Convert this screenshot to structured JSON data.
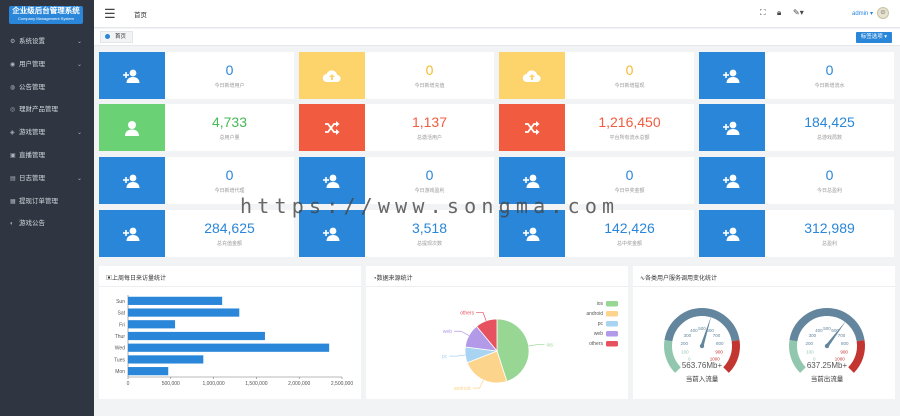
{
  "logo": {
    "title": "企业级后台管理系统",
    "subtitle": "Company Management System"
  },
  "sidebar": {
    "items": [
      {
        "label": "系统设置",
        "icon": "gear-icon",
        "chevron": true
      },
      {
        "label": "用户管理",
        "icon": "user-icon",
        "chevron": true
      },
      {
        "label": "公告管理",
        "icon": "bell-icon",
        "chevron": false
      },
      {
        "label": "理财产品管理",
        "icon": "coin-icon",
        "chevron": false
      },
      {
        "label": "游戏管理",
        "icon": "gamepad-icon",
        "chevron": true
      },
      {
        "label": "直播管理",
        "icon": "video-icon",
        "chevron": false
      },
      {
        "label": "日志管理",
        "icon": "log-icon",
        "chevron": true
      },
      {
        "label": "提现订单管理",
        "icon": "order-icon",
        "chevron": false
      },
      {
        "label": "游戏公告",
        "icon": "megaphone-icon",
        "chevron": false
      }
    ]
  },
  "header": {
    "home": "首页",
    "user": "admin ▾"
  },
  "tabbar": {
    "tab_home": "首页",
    "page_ops": "标签选项 ▾"
  },
  "cards": [
    {
      "value": "0",
      "label": "今日新增用户",
      "color": "blue",
      "icon": "user-add-icon"
    },
    {
      "value": "0",
      "label": "今日新增充值",
      "color": "yellow",
      "icon": "cloud-upload-icon"
    },
    {
      "value": "0",
      "label": "今日新增提现",
      "color": "yellow",
      "icon": "cloud-upload-icon"
    },
    {
      "value": "0",
      "label": "今日新增流水",
      "color": "blue",
      "icon": "user-add-icon"
    },
    {
      "value": "4,733",
      "label": "总用户量",
      "color": "green",
      "icon": "user-icon"
    },
    {
      "value": "1,137",
      "label": "总激活用户",
      "color": "red",
      "icon": "shuffle-icon"
    },
    {
      "value": "1,216,450",
      "label": "平台所有流水总额",
      "color": "red",
      "icon": "shuffle-icon"
    },
    {
      "value": "184,425",
      "label": "总游戏局数",
      "color": "blue",
      "icon": "user-add-icon"
    },
    {
      "value": "0",
      "label": "今日新增代理",
      "color": "blue",
      "icon": "user-add-icon"
    },
    {
      "value": "0",
      "label": "今日游戏盈利",
      "color": "blue",
      "icon": "user-add-icon"
    },
    {
      "value": "0",
      "label": "今日中奖金额",
      "color": "blue",
      "icon": "user-add-icon"
    },
    {
      "value": "0",
      "label": "今日总盈利",
      "color": "blue",
      "icon": "user-add-icon"
    },
    {
      "value": "284,625",
      "label": "总充值金额",
      "color": "blue",
      "icon": "user-add-icon"
    },
    {
      "value": "3,518",
      "label": "总提现次数",
      "color": "blue",
      "icon": "user-add-icon"
    },
    {
      "value": "142,426",
      "label": "总中奖金额",
      "color": "blue",
      "icon": "user-add-icon"
    },
    {
      "value": "312,989",
      "label": "总盈利",
      "color": "blue",
      "icon": "user-add-icon"
    }
  ],
  "colors": {
    "blue": "#2a86d8",
    "yellow": "#fdd46c",
    "green": "#6ad275",
    "red": "#f15c40",
    "sidebar": "#2f3541"
  },
  "watermark": "https://www.songma.com",
  "panels": {
    "bar_title": "上周每日来访量统计",
    "pie_title": "数据来源统计",
    "gauge_title": "各类用户服务调用变化统计"
  },
  "chart_data": [
    {
      "type": "bar",
      "orientation": "horizontal",
      "title": "上周每日来访量统计",
      "categories": [
        "Sun",
        "Sat",
        "Fri",
        "Thur",
        "Wed",
        "Tues",
        "Mon"
      ],
      "values": [
        1100000,
        1300000,
        550000,
        1600000,
        2350000,
        880000,
        470000
      ],
      "xlim": [
        0,
        2500000
      ],
      "ticks": [
        "0",
        "500,000",
        "1,000,000",
        "1,500,000",
        "2,000,000",
        "2,500,000"
      ],
      "color": "#2a86d8"
    },
    {
      "type": "pie",
      "title": "数据来源统计",
      "slices": [
        {
          "name": "ios",
          "value": 45,
          "color": "#98d694"
        },
        {
          "name": "android",
          "value": 24,
          "color": "#fdd48c"
        },
        {
          "name": "pc",
          "value": 8,
          "color": "#a8d3f1"
        },
        {
          "name": "web",
          "value": 12,
          "color": "#b39ae8"
        },
        {
          "name": "others",
          "value": 11,
          "color": "#e6525f"
        }
      ],
      "legend_position": "top-right"
    },
    {
      "type": "gauge",
      "title": "各类用户服务调用变化统计",
      "gauges": [
        {
          "name": "当前入流量",
          "value_text": "563.76Mb+",
          "value": 563.76,
          "range": [
            0,
            1000
          ],
          "ticks": [
            "0",
            "100",
            "200",
            "300",
            "400",
            "500",
            "600",
            "700",
            "800",
            "900",
            "1000"
          ]
        },
        {
          "name": "当前出流量",
          "value_text": "637.25Mb+",
          "value": 637.25,
          "range": [
            0,
            1000
          ],
          "ticks": [
            "0",
            "100",
            "200",
            "300",
            "400",
            "500",
            "600",
            "700",
            "800",
            "900",
            "1000"
          ]
        }
      ]
    }
  ]
}
